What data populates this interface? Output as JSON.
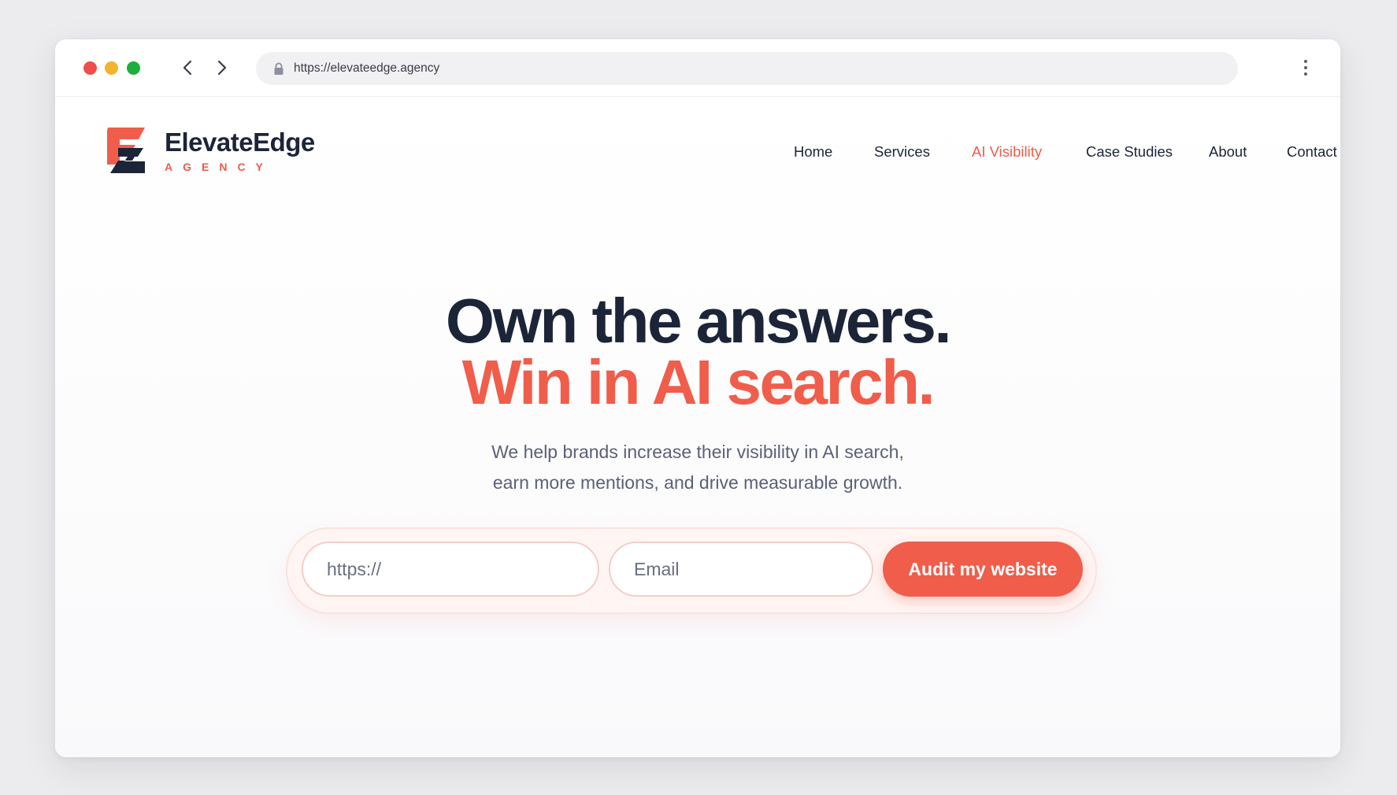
{
  "window": {
    "dots": [
      {
        "name": "close",
        "color": "#f04e4a"
      },
      {
        "name": "minimize",
        "color": "#f4b32c"
      },
      {
        "name": "maximize",
        "color": "#1fad3e"
      }
    ],
    "address": "https://elevateedge.agency"
  },
  "brand": {
    "name": "ElevateEdge",
    "sub": "AGENCY",
    "primary_color": "#1c2438",
    "accent_color": "#f05d4b"
  },
  "nav": {
    "items": [
      {
        "label": "Home",
        "active": false
      },
      {
        "label": "Services",
        "active": false
      },
      {
        "label": "AI Visibility",
        "active": true
      },
      {
        "label": "Case Studies",
        "active": false
      },
      {
        "label": "About",
        "active": false
      },
      {
        "label": "Contact",
        "active": false
      }
    ]
  },
  "hero": {
    "title_line1": "Own the answers.",
    "title_line2": "Win in AI search.",
    "subtitle_line1": "We help brands increase their visibility in AI search,",
    "subtitle_line2": "earn more mentions, and drive measurable growth."
  },
  "form": {
    "url_placeholder": "https://",
    "email_placeholder": "Email",
    "submit_label": "Audit my website"
  }
}
